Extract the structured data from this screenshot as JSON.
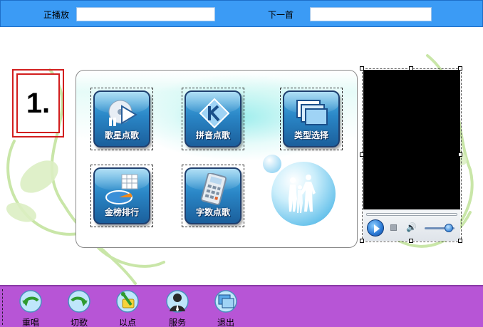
{
  "header": {
    "now_playing_label": "正播放",
    "now_playing_value": "",
    "next_label": "下一首",
    "next_value": ""
  },
  "step_badge": "1.",
  "menu": {
    "tiles": [
      {
        "label": "歌星点歌",
        "icon": "disc-play-icon"
      },
      {
        "label": "拼音点歌",
        "icon": "k-letter-icon"
      },
      {
        "label": "类型选择",
        "icon": "windows-stack-icon"
      },
      {
        "label": "金榜排行",
        "icon": "pie-chart-icon"
      },
      {
        "label": "字数点歌",
        "icon": "calculator-icon"
      }
    ]
  },
  "bottom_nav": [
    {
      "label": "重唱",
      "icon": "replay-icon"
    },
    {
      "label": "切歌",
      "icon": "skip-icon"
    },
    {
      "label": "以点",
      "icon": "selected-list-icon"
    },
    {
      "label": "服务",
      "icon": "service-person-icon"
    },
    {
      "label": "退出",
      "icon": "exit-icon"
    }
  ],
  "colors": {
    "top_bar": "#3b9bf5",
    "bottom_bar": "#b755d6",
    "tile_blue": "#2a86c6",
    "badge_red": "#d21e1e"
  }
}
